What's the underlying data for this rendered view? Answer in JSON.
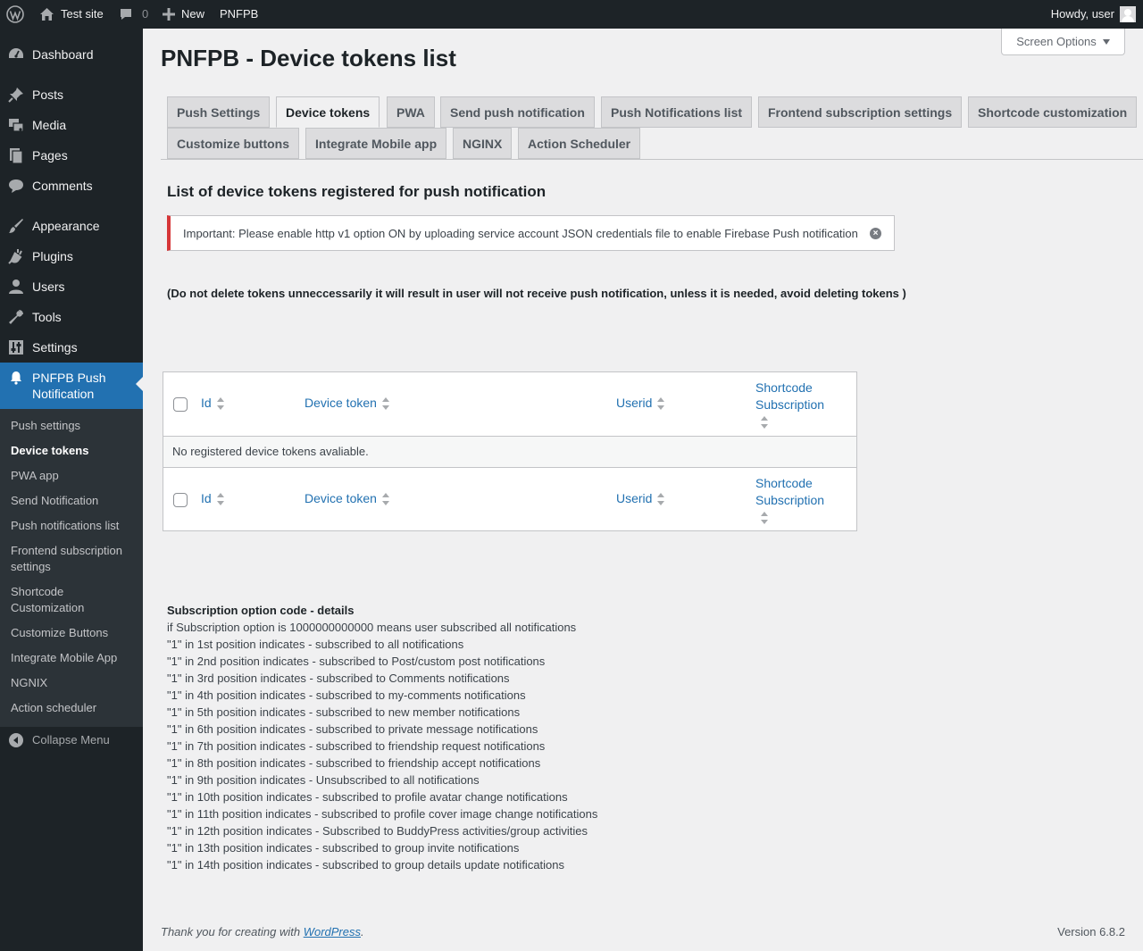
{
  "adminbar": {
    "site_name": "Test site",
    "comments_count": "0",
    "new_label": "New",
    "plugin_label": "PNFPB",
    "howdy": "Howdy, user"
  },
  "sidebar": {
    "dashboard": "Dashboard",
    "posts": "Posts",
    "media": "Media",
    "pages": "Pages",
    "comments": "Comments",
    "appearance": "Appearance",
    "plugins": "Plugins",
    "users": "Users",
    "tools": "Tools",
    "settings": "Settings",
    "pnfpb_line1": "PNFPB Push",
    "pnfpb_line2": "Notification",
    "submenu": {
      "push_settings": "Push settings",
      "device_tokens": "Device tokens",
      "pwa_app": "PWA app",
      "send_notification": "Send Notification",
      "push_notifications_list": "Push notifications list",
      "frontend_subscription_line1": "Frontend subscription",
      "frontend_subscription_line2": "settings",
      "shortcode_line1": "Shortcode",
      "shortcode_line2": "Customization",
      "customize_buttons": "Customize Buttons",
      "integrate_mobile_app": "Integrate Mobile App",
      "ngnix": "NGNIX",
      "action_scheduler": "Action scheduler"
    },
    "collapse": "Collapse Menu"
  },
  "main": {
    "screen_options": "Screen Options",
    "page_title": "PNFPB - Device tokens list",
    "tabs": {
      "push_settings": "Push Settings",
      "device_tokens": "Device tokens",
      "pwa": "PWA",
      "send_push": "Send push notification",
      "push_list": "Push Notifications list",
      "frontend_settings": "Frontend subscription settings",
      "shortcode_customization": "Shortcode customization",
      "customize_buttons": "Customize buttons",
      "integrate_mobile": "Integrate Mobile app",
      "nginx": "NGINX",
      "action_scheduler": "Action Scheduler"
    },
    "section_title": "List of device tokens registered for push notification",
    "notice": "Important: Please enable http v1 option ON by uploading service account JSON credentials file to enable Firebase Push notification",
    "warning": "(Do not delete tokens unneccessarily it will result in user will not receive push notification, unless it is needed, avoid deleting tokens )",
    "table": {
      "col_id": "Id",
      "col_token": "Device token",
      "col_userid": "Userid",
      "col_shortcode_line1": "Shortcode",
      "col_shortcode_line2": "Subscription",
      "empty": "No registered device tokens avaliable."
    },
    "codes": {
      "title": "Subscription option code - details",
      "lines": [
        "if Subscription option is 1000000000000 means user subscribed all notifications",
        "\"1\" in 1st position indicates - subscribed to all notifications",
        "\"1\" in 2nd position indicates - subscribed to Post/custom post notifications",
        "\"1\" in 3rd position indicates - subscribed to Comments notifications",
        "\"1\" in 4th position indicates - subscribed to my-comments notifications",
        "\"1\" in 5th position indicates - subscribed to new member notifications",
        "\"1\" in 6th position indicates - subscribed to private message notifications",
        "\"1\" in 7th position indicates - subscribed to friendship request notifications",
        "\"1\" in 8th position indicates - subscribed to friendship accept notifications",
        "\"1\" in 9th position indicates - Unsubscribed to all notifications",
        "\"1\" in 10th position indicates - subscribed to profile avatar change notifications",
        "\"1\" in 11th position indicates - subscribed to profile cover image change notifications",
        "\"1\" in 12th position indicates - Subscribed to BuddyPress activities/group activities",
        "\"1\" in 13th position indicates - subscribed to group invite notifications",
        "\"1\" in 14th position indicates - subscribed to group details update notifications"
      ]
    }
  },
  "footer": {
    "thanks_prefix": "Thank you for creating with ",
    "wordpress_link": "WordPress",
    "thanks_suffix": ".",
    "version": "Version 6.8.2"
  }
}
